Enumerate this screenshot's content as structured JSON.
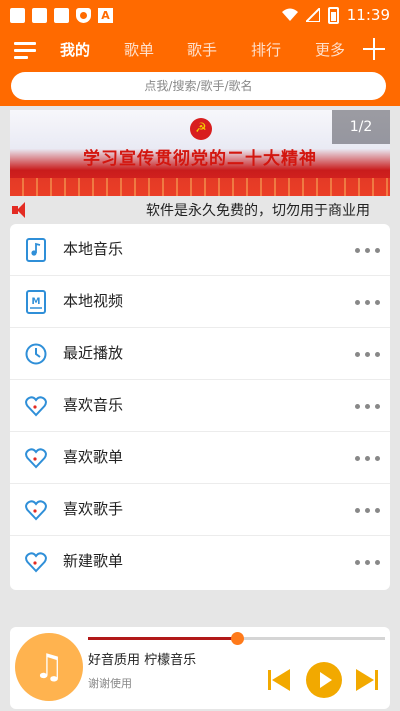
{
  "statusbar": {
    "time": "11:39",
    "notif_letter": "A"
  },
  "nav": {
    "tabs": [
      {
        "label": "我的",
        "active": true
      },
      {
        "label": "歌单"
      },
      {
        "label": "歌手"
      },
      {
        "label": "排行"
      },
      {
        "label": "更多"
      }
    ]
  },
  "search": {
    "placeholder": "点我/搜索/歌手/歌名"
  },
  "banner": {
    "title": "学习宣传贯彻党的二十大精神",
    "page_indicator": "1/2"
  },
  "marquee": {
    "text": "软件是永久免费的，切勿用于商业用"
  },
  "library": {
    "items": [
      {
        "label": "本地音乐",
        "icon": "music-file-icon"
      },
      {
        "label": "本地视频",
        "icon": "video-file-icon"
      },
      {
        "label": "最近播放",
        "icon": "clock-icon"
      },
      {
        "label": "喜欢音乐",
        "icon": "heart-icon"
      },
      {
        "label": "喜欢歌单",
        "icon": "heart-icon"
      },
      {
        "label": "喜欢歌手",
        "icon": "heart-icon"
      },
      {
        "label": "新建歌单",
        "icon": "heart-icon"
      }
    ]
  },
  "player": {
    "title": "好音质用 柠檬音乐",
    "subtitle": "谢谢使用",
    "progress": 0.5
  },
  "colors": {
    "accent": "#ff6a00",
    "icon_blue": "#2f8fd8",
    "player_accent": "#f2a900"
  }
}
